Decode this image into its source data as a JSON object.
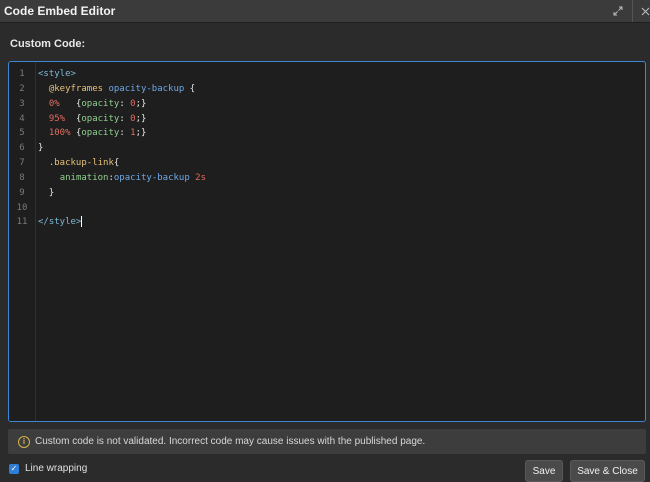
{
  "window": {
    "title": "Code Embed Editor",
    "expand_icon": "expand-icon",
    "close_icon": "close-icon"
  },
  "editor": {
    "label": "Custom Code:",
    "line_numbers": [
      "1",
      "2",
      "3",
      "4",
      "5",
      "6",
      "7",
      "8",
      "9",
      "10",
      "11"
    ],
    "lines": [
      [
        {
          "t": "<style>",
          "c": "tag"
        }
      ],
      [
        {
          "t": "  ",
          "c": "brace"
        },
        {
          "t": "@keyframes",
          "c": "at"
        },
        {
          "t": " ",
          "c": "brace"
        },
        {
          "t": "opacity-backup",
          "c": "name"
        },
        {
          "t": " {",
          "c": "brace"
        }
      ],
      [
        {
          "t": "  ",
          "c": "brace"
        },
        {
          "t": "0%",
          "c": "pct"
        },
        {
          "t": "   {",
          "c": "brace"
        },
        {
          "t": "opacity",
          "c": "prop"
        },
        {
          "t": ": ",
          "c": "brace"
        },
        {
          "t": "0",
          "c": "num"
        },
        {
          "t": ";}",
          "c": "brace"
        }
      ],
      [
        {
          "t": "  ",
          "c": "brace"
        },
        {
          "t": "95%",
          "c": "pct"
        },
        {
          "t": "  {",
          "c": "brace"
        },
        {
          "t": "opacity",
          "c": "prop"
        },
        {
          "t": ": ",
          "c": "brace"
        },
        {
          "t": "0",
          "c": "num"
        },
        {
          "t": ";}",
          "c": "brace"
        }
      ],
      [
        {
          "t": "  ",
          "c": "brace"
        },
        {
          "t": "100%",
          "c": "pct"
        },
        {
          "t": " {",
          "c": "brace"
        },
        {
          "t": "opacity",
          "c": "prop"
        },
        {
          "t": ": ",
          "c": "brace"
        },
        {
          "t": "1",
          "c": "num"
        },
        {
          "t": ";}",
          "c": "brace"
        }
      ],
      [
        {
          "t": "}",
          "c": "brace"
        }
      ],
      [
        {
          "t": "  ",
          "c": "brace"
        },
        {
          "t": ".backup-link",
          "c": "sel"
        },
        {
          "t": "{",
          "c": "brace"
        }
      ],
      [
        {
          "t": "    ",
          "c": "brace"
        },
        {
          "t": "animation",
          "c": "attr"
        },
        {
          "t": ":",
          "c": "brace"
        },
        {
          "t": "opacity-backup",
          "c": "name"
        },
        {
          "t": " ",
          "c": "brace"
        },
        {
          "t": "2s",
          "c": "num"
        }
      ],
      [
        {
          "t": "  }",
          "c": "brace"
        }
      ],
      [],
      [
        {
          "t": "</style>",
          "c": "tag"
        }
      ]
    ]
  },
  "notice": {
    "icon": "info-icon",
    "text": "Custom code is not validated. Incorrect code may cause issues with the published page."
  },
  "footer": {
    "line_wrapping_label": "Line wrapping",
    "line_wrapping_checked": true,
    "save_label": "Save",
    "save_close_label": "Save & Close"
  }
}
